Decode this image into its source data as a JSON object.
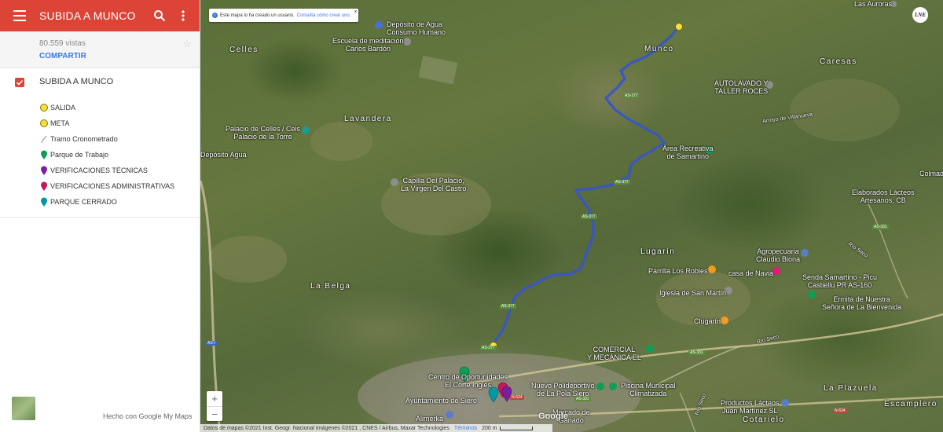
{
  "sidebar": {
    "title": "SUBIDA A MUNCO",
    "views": "80.559 vistas",
    "share_label": "COMPARTIR",
    "layer_name": "SUBIDA A MUNCO",
    "legend": [
      {
        "label": "SALIDA",
        "icon": "yellow-circle-icon",
        "color": "#f5e042"
      },
      {
        "label": "META",
        "icon": "yellow-circle-icon",
        "color": "#f5e042"
      },
      {
        "label": "Tramo Cronometrado",
        "icon": "line-icon",
        "color": "#3a56c4"
      },
      {
        "label": "Parque de Trabajo",
        "icon": "green-pin-icon",
        "color": "#0f9d58"
      },
      {
        "label": "VERIFICACIONES TÉCNICAS",
        "icon": "purple-pin-icon",
        "color": "#7b1fa2"
      },
      {
        "label": "VERIFICACIONES ADMINISTRATIVAS",
        "icon": "red-pin-icon",
        "color": "#c2185b"
      },
      {
        "label": "PARQUE CERRADO",
        "icon": "teal-pin-icon",
        "color": "#0097a7"
      }
    ],
    "credit": "Hecho con Google My Maps"
  },
  "map": {
    "notice_text": "Este mapa lo ha creado un usuario.",
    "notice_link": "Consulta cómo crear uno.",
    "logo_text": "LNE",
    "zoom_in": "+",
    "zoom_out": "−",
    "google_logo": "Google",
    "attribution": "Datos de mapas ©2021 Inst. Geogr. Nacional Imágenes ©2021 , CNES / Airbus, Maxar Technologies",
    "terms": "Términos",
    "scale": "200 m",
    "route_color": "#3a56c4",
    "labels": {
      "las_auroras": "Las Auroras",
      "deposito": "Depósito de Agua\nConsumo Humano",
      "escuela": "Escuela de meditación\nCarlos Bardón",
      "celles": "Celles",
      "munco": "Munco",
      "caresas": "Caresas",
      "autolavado": "AUTOLAVADO Y\nTALLER ROCES",
      "lavandera": "Lavandera",
      "villanueva": "Arroyo de Villanueva",
      "palacio_celles": "Palacio de Celles / Ceis\nPalacio de la Torre",
      "deposito_agua": "Depósito Agua",
      "area_recreativa": "Área Recreativa\nde Samartino",
      "colmado": "Colmad",
      "capilla": "Capilla Del Palacio,\nLa Virgen Del Castro",
      "elaborados": "Elaborados Lácteos\nArtesanos, CB",
      "as331": "AS-331",
      "agropecuaria": "Agropecuaria\nClaudio Biona",
      "lugarin": "Lugarín",
      "rio_seco": "Río Seco",
      "parrilla": "Parrilla Los Robles",
      "casa_navia": "casa de Navia",
      "senda": "Senda Samartino - Picu\nCastiellu PR AS-160",
      "la_belga": "La Belga",
      "iglesia": "Iglesia de San Martín",
      "ermita": "Ermita de Nuestra\nSeñora de La Bienvenida",
      "clugarin": "Clugarín",
      "rio_seco2": "Río Seco",
      "comercial": "COMERCIAL\nY MECÁNICA EL",
      "as331b": "AS-331",
      "centro": "Centro de Oportunidades\nEl Corte Inglés",
      "nuevo_poli": "Nuevo Polideportivo\nde La Pola Siero",
      "piscina": "Piscina Municipal\nClimatizada",
      "la_plazuela": "La Plazuela",
      "ayuntamiento": "Ayuntamiento de Siero",
      "alimerka": "Alimerka",
      "mercado": "Mercado de\nGanado",
      "productos": "Productos Lácteos\nJuan Martínez SL",
      "escamplero": "Escamplero",
      "cotarielo": "Cotarielo",
      "n634": "N-634",
      "n634b": "N-634",
      "as1": "AS-I",
      "as377a": "AS-377",
      "as377b": "AS-377",
      "as377c": "AS-377",
      "as377d": "AS-377",
      "as377e": "AS-377",
      "as331c": "AS-331",
      "rio_seco3": "Río Seco"
    }
  }
}
